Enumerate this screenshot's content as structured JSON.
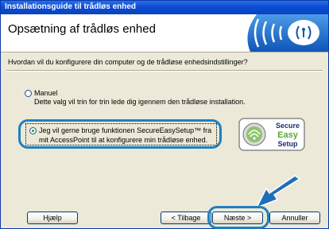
{
  "window": {
    "title": "Installationsguide til trådløs enhed"
  },
  "header": {
    "title": "Opsætning af trådløs enhed"
  },
  "question": "Hvordan vil du konfigurere din computer og de trådløse enhedsindstillinger?",
  "options": [
    {
      "label": "Manuel",
      "description": "Dette valg vil trin for trin lede dig igennem den trådløse installation.",
      "selected": false
    },
    {
      "label": "Jeg vil gerne bruge funktionen SecureEasySetup™ fra mit AccessPoint til at konfigurere min trådløse enhed.",
      "selected": true
    }
  ],
  "ses_logo": {
    "line1": "Secure",
    "line2": "Easy",
    "line3": "Setup"
  },
  "buttons": {
    "help": "Hjælp",
    "back": "< Tilbage",
    "next": "Næste >",
    "cancel": "Annuller"
  },
  "colors": {
    "accent": "#1f7fc0",
    "titlebar": "#0b4cd4",
    "easy_green": "#5aa83a"
  }
}
